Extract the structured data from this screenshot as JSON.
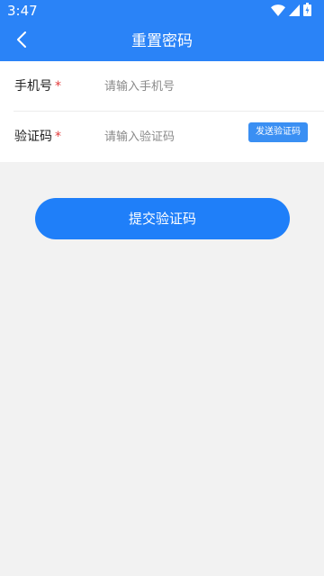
{
  "status_bar": {
    "time": "3:47",
    "icons": [
      "wifi-icon",
      "signal-icon",
      "battery-icon"
    ]
  },
  "app_bar": {
    "title": "重置密码",
    "back_icon": "chevron-left-icon"
  },
  "form": {
    "phone": {
      "label": "手机号",
      "required_mark": "*",
      "placeholder": "请输入手机号",
      "value": ""
    },
    "code": {
      "label": "验证码",
      "required_mark": "*",
      "placeholder": "请输入验证码",
      "value": "",
      "send_button_label": "发送验证码"
    }
  },
  "submit_label": "提交验证码",
  "colors": {
    "primary": "#2a83f7",
    "background": "#f2f2f2",
    "required": "#e23b3b"
  }
}
